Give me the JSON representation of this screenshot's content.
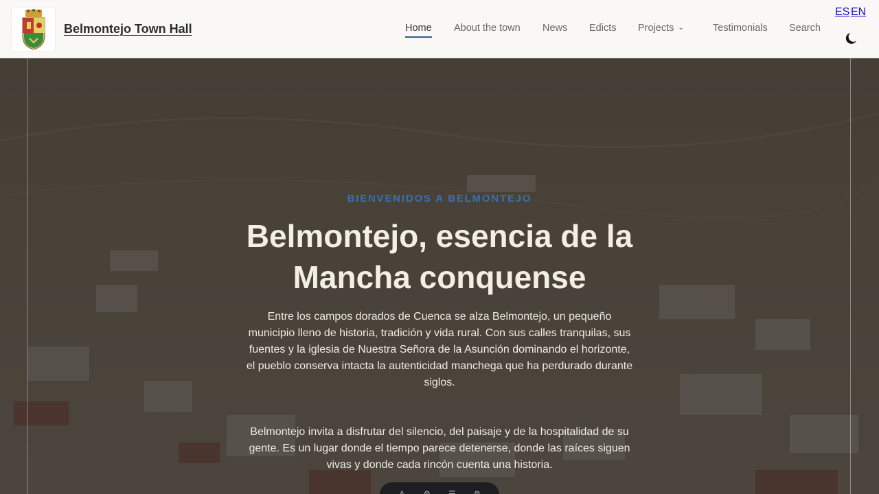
{
  "header": {
    "site_title": "Belmontejo Town Hall",
    "logo_icon": "coat-of-arms-icon",
    "nav": [
      {
        "label": "Home",
        "active": true
      },
      {
        "label": "About the town"
      },
      {
        "label": "News"
      },
      {
        "label": "Edicts"
      },
      {
        "label": "Projects",
        "has_dropdown": true
      },
      {
        "label": "Testimonials"
      },
      {
        "label": "Search"
      }
    ],
    "lang": {
      "es": "ES",
      "en": "EN"
    },
    "theme_toggle_icon": "moon-icon"
  },
  "hero": {
    "eyebrow": "BIENVENIDOS A BELMONTEJO",
    "title": "Belmontejo, esencia de la Mancha conquense",
    "paragraph_1": "Entre los campos dorados de Cuenca se alza Belmontejo, un pequeño municipio lleno de historia, tradición y vida rural. Con sus calles tranquilas, sus fuentes y la iglesia de Nuestra Señora de la Asunción dominando el horizonte, el pueblo conserva intacta la autenticidad manchega que ha perdurado durante siglos.",
    "paragraph_2": "Belmontejo invita a disfrutar del silencio, del paisaje y de la hospitalidad de su gente. Es un lugar donde el tiempo parece detenerse, donde las raíces siguen vivas y donde cada rincón cuenta una historia."
  },
  "colors": {
    "accent": "#2e5a8c",
    "eyebrow": "#3a6fb0",
    "header_bg": "#f9f8f6",
    "hero_title": "#f4efe6"
  }
}
